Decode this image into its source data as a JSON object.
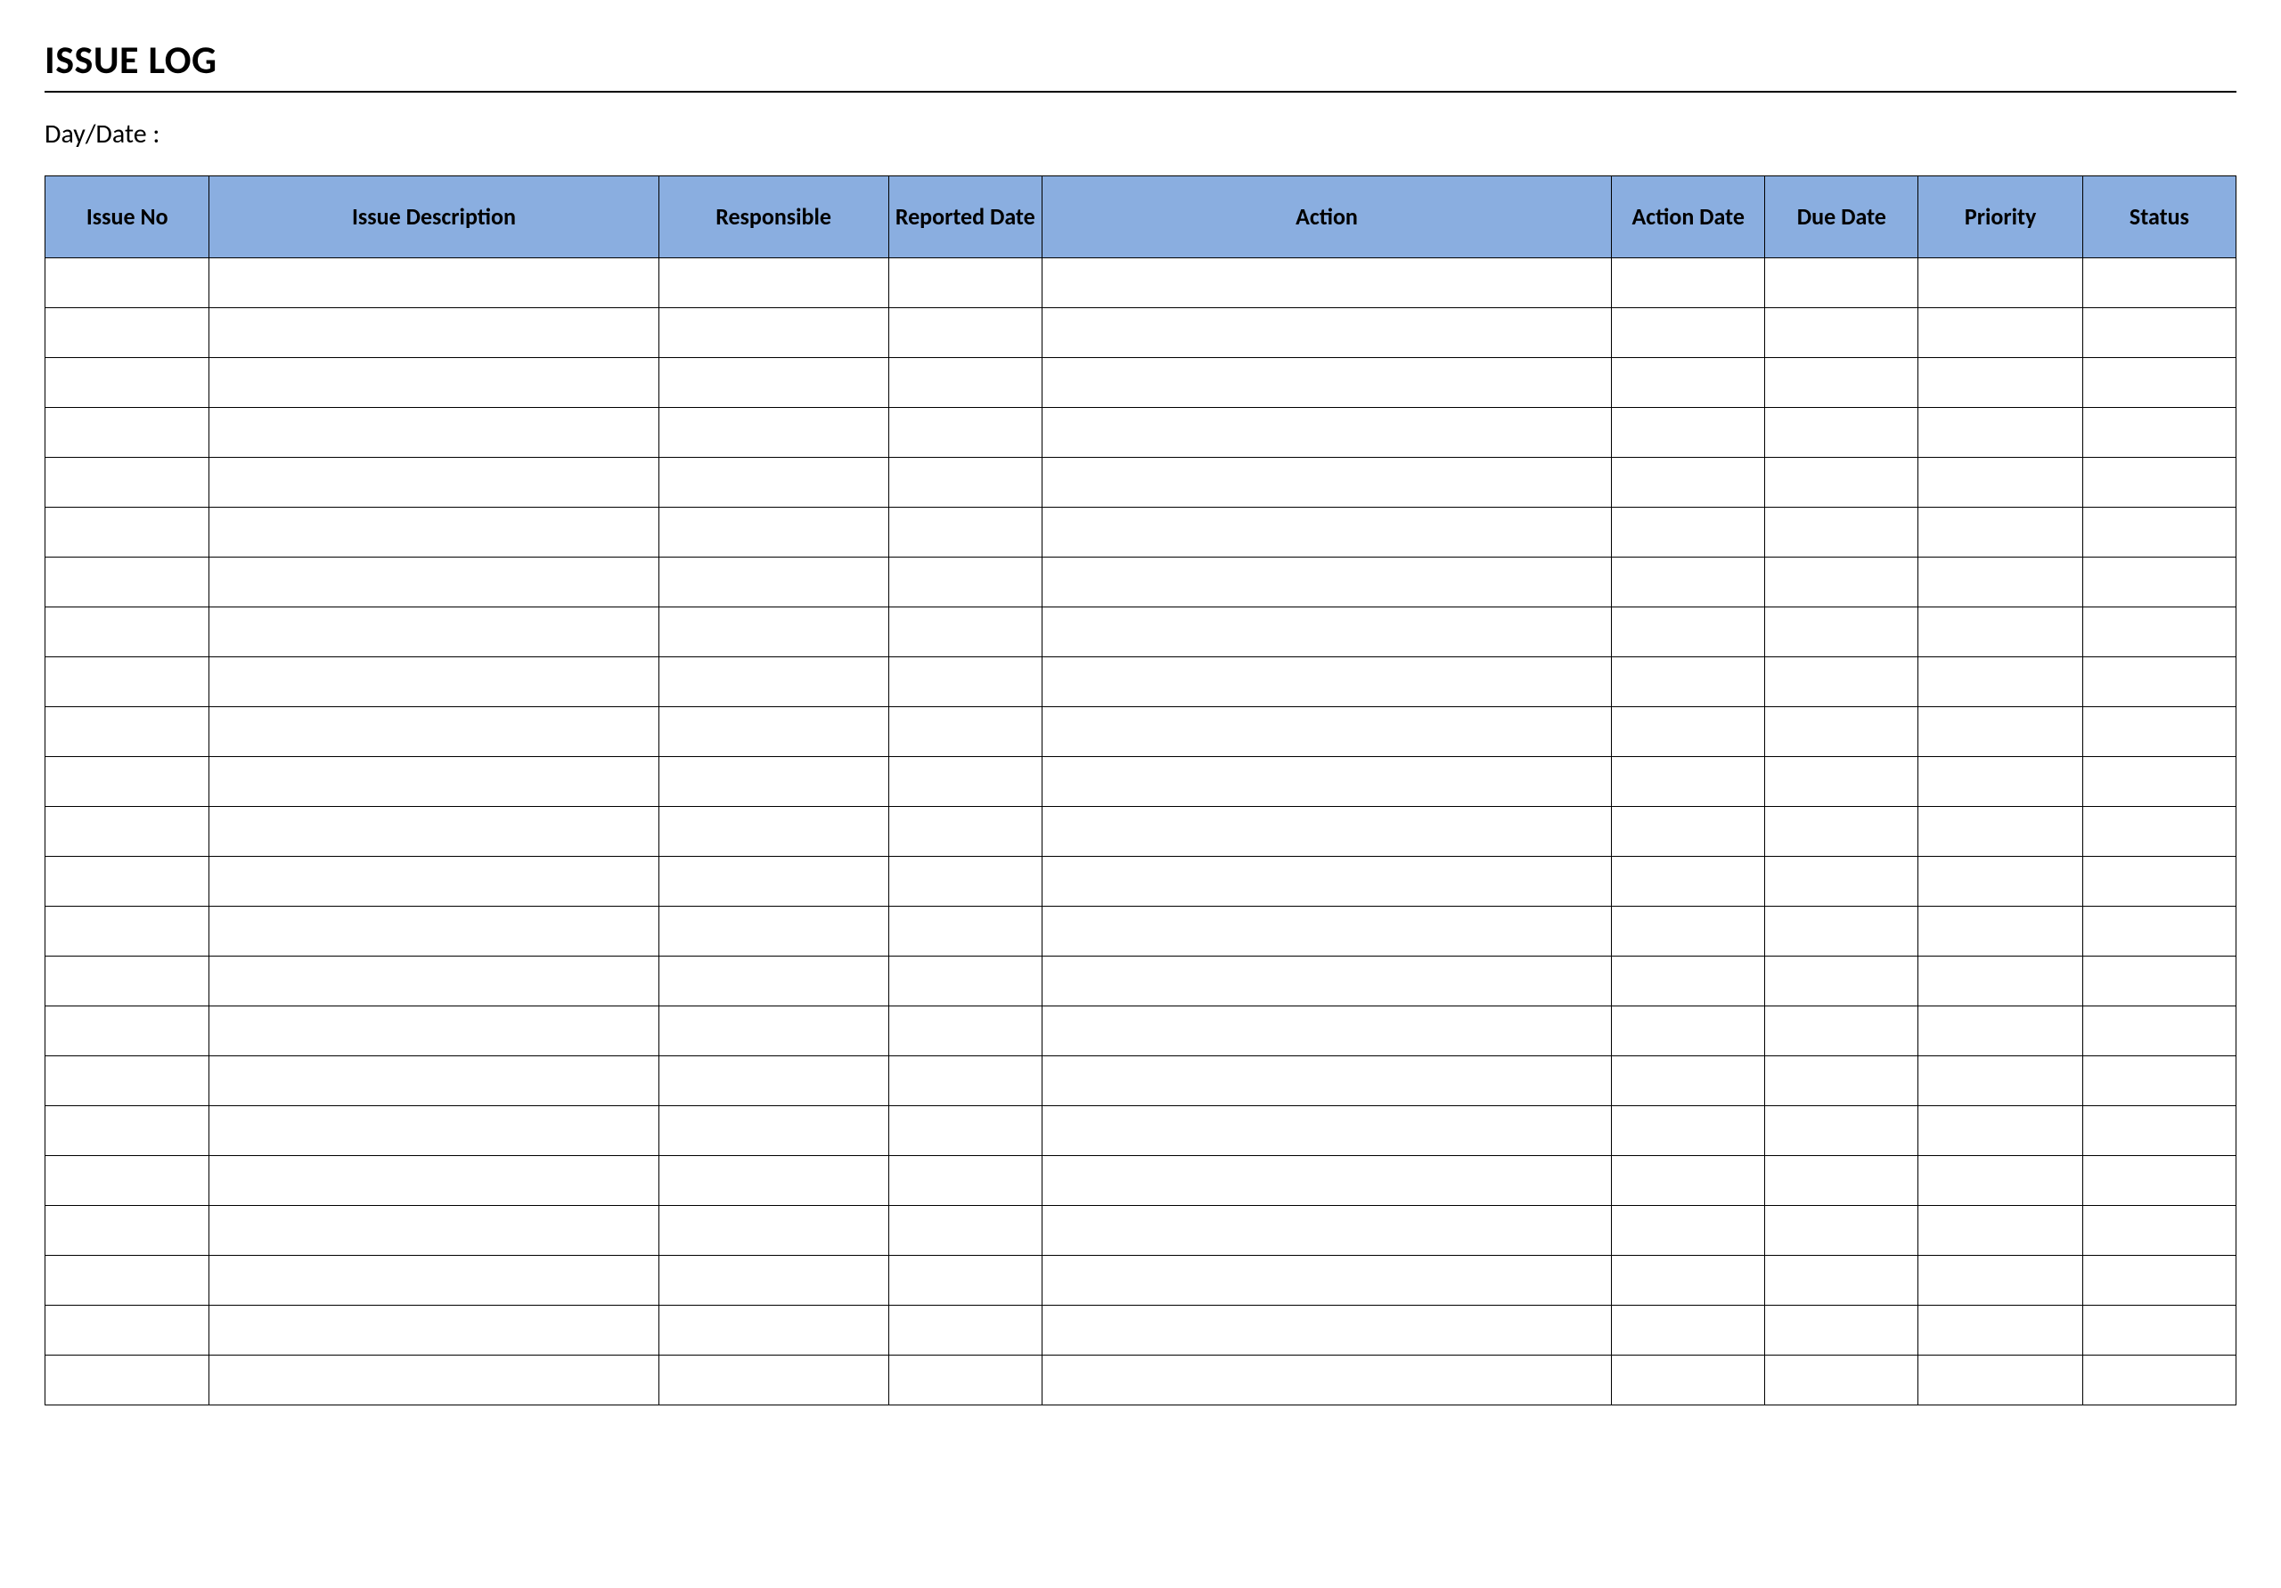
{
  "title": "ISSUE LOG",
  "day_date_label": "Day/Date :",
  "columns": [
    {
      "key": "issue_no",
      "label": "Issue No"
    },
    {
      "key": "issue_desc",
      "label": "Issue Description"
    },
    {
      "key": "responsible",
      "label": "Responsible"
    },
    {
      "key": "reported",
      "label": "Reported Date"
    },
    {
      "key": "action",
      "label": "Action"
    },
    {
      "key": "action_date",
      "label": "Action Date"
    },
    {
      "key": "due_date",
      "label": "Due Date"
    },
    {
      "key": "priority",
      "label": "Priority"
    },
    {
      "key": "status",
      "label": "Status"
    }
  ],
  "rows": [
    {
      "issue_no": "",
      "issue_desc": "",
      "responsible": "",
      "reported": "",
      "action": "",
      "action_date": "",
      "due_date": "",
      "priority": "",
      "status": ""
    },
    {
      "issue_no": "",
      "issue_desc": "",
      "responsible": "",
      "reported": "",
      "action": "",
      "action_date": "",
      "due_date": "",
      "priority": "",
      "status": ""
    },
    {
      "issue_no": "",
      "issue_desc": "",
      "responsible": "",
      "reported": "",
      "action": "",
      "action_date": "",
      "due_date": "",
      "priority": "",
      "status": ""
    },
    {
      "issue_no": "",
      "issue_desc": "",
      "responsible": "",
      "reported": "",
      "action": "",
      "action_date": "",
      "due_date": "",
      "priority": "",
      "status": ""
    },
    {
      "issue_no": "",
      "issue_desc": "",
      "responsible": "",
      "reported": "",
      "action": "",
      "action_date": "",
      "due_date": "",
      "priority": "",
      "status": ""
    },
    {
      "issue_no": "",
      "issue_desc": "",
      "responsible": "",
      "reported": "",
      "action": "",
      "action_date": "",
      "due_date": "",
      "priority": "",
      "status": ""
    },
    {
      "issue_no": "",
      "issue_desc": "",
      "responsible": "",
      "reported": "",
      "action": "",
      "action_date": "",
      "due_date": "",
      "priority": "",
      "status": ""
    },
    {
      "issue_no": "",
      "issue_desc": "",
      "responsible": "",
      "reported": "",
      "action": "",
      "action_date": "",
      "due_date": "",
      "priority": "",
      "status": ""
    },
    {
      "issue_no": "",
      "issue_desc": "",
      "responsible": "",
      "reported": "",
      "action": "",
      "action_date": "",
      "due_date": "",
      "priority": "",
      "status": ""
    },
    {
      "issue_no": "",
      "issue_desc": "",
      "responsible": "",
      "reported": "",
      "action": "",
      "action_date": "",
      "due_date": "",
      "priority": "",
      "status": ""
    },
    {
      "issue_no": "",
      "issue_desc": "",
      "responsible": "",
      "reported": "",
      "action": "",
      "action_date": "",
      "due_date": "",
      "priority": "",
      "status": ""
    },
    {
      "issue_no": "",
      "issue_desc": "",
      "responsible": "",
      "reported": "",
      "action": "",
      "action_date": "",
      "due_date": "",
      "priority": "",
      "status": ""
    },
    {
      "issue_no": "",
      "issue_desc": "",
      "responsible": "",
      "reported": "",
      "action": "",
      "action_date": "",
      "due_date": "",
      "priority": "",
      "status": ""
    },
    {
      "issue_no": "",
      "issue_desc": "",
      "responsible": "",
      "reported": "",
      "action": "",
      "action_date": "",
      "due_date": "",
      "priority": "",
      "status": ""
    },
    {
      "issue_no": "",
      "issue_desc": "",
      "responsible": "",
      "reported": "",
      "action": "",
      "action_date": "",
      "due_date": "",
      "priority": "",
      "status": ""
    },
    {
      "issue_no": "",
      "issue_desc": "",
      "responsible": "",
      "reported": "",
      "action": "",
      "action_date": "",
      "due_date": "",
      "priority": "",
      "status": ""
    },
    {
      "issue_no": "",
      "issue_desc": "",
      "responsible": "",
      "reported": "",
      "action": "",
      "action_date": "",
      "due_date": "",
      "priority": "",
      "status": ""
    },
    {
      "issue_no": "",
      "issue_desc": "",
      "responsible": "",
      "reported": "",
      "action": "",
      "action_date": "",
      "due_date": "",
      "priority": "",
      "status": ""
    },
    {
      "issue_no": "",
      "issue_desc": "",
      "responsible": "",
      "reported": "",
      "action": "",
      "action_date": "",
      "due_date": "",
      "priority": "",
      "status": ""
    },
    {
      "issue_no": "",
      "issue_desc": "",
      "responsible": "",
      "reported": "",
      "action": "",
      "action_date": "",
      "due_date": "",
      "priority": "",
      "status": ""
    },
    {
      "issue_no": "",
      "issue_desc": "",
      "responsible": "",
      "reported": "",
      "action": "",
      "action_date": "",
      "due_date": "",
      "priority": "",
      "status": ""
    },
    {
      "issue_no": "",
      "issue_desc": "",
      "responsible": "",
      "reported": "",
      "action": "",
      "action_date": "",
      "due_date": "",
      "priority": "",
      "status": ""
    },
    {
      "issue_no": "",
      "issue_desc": "",
      "responsible": "",
      "reported": "",
      "action": "",
      "action_date": "",
      "due_date": "",
      "priority": "",
      "status": ""
    }
  ],
  "colors": {
    "header_bg": "#8aaee0",
    "border": "#000000"
  }
}
